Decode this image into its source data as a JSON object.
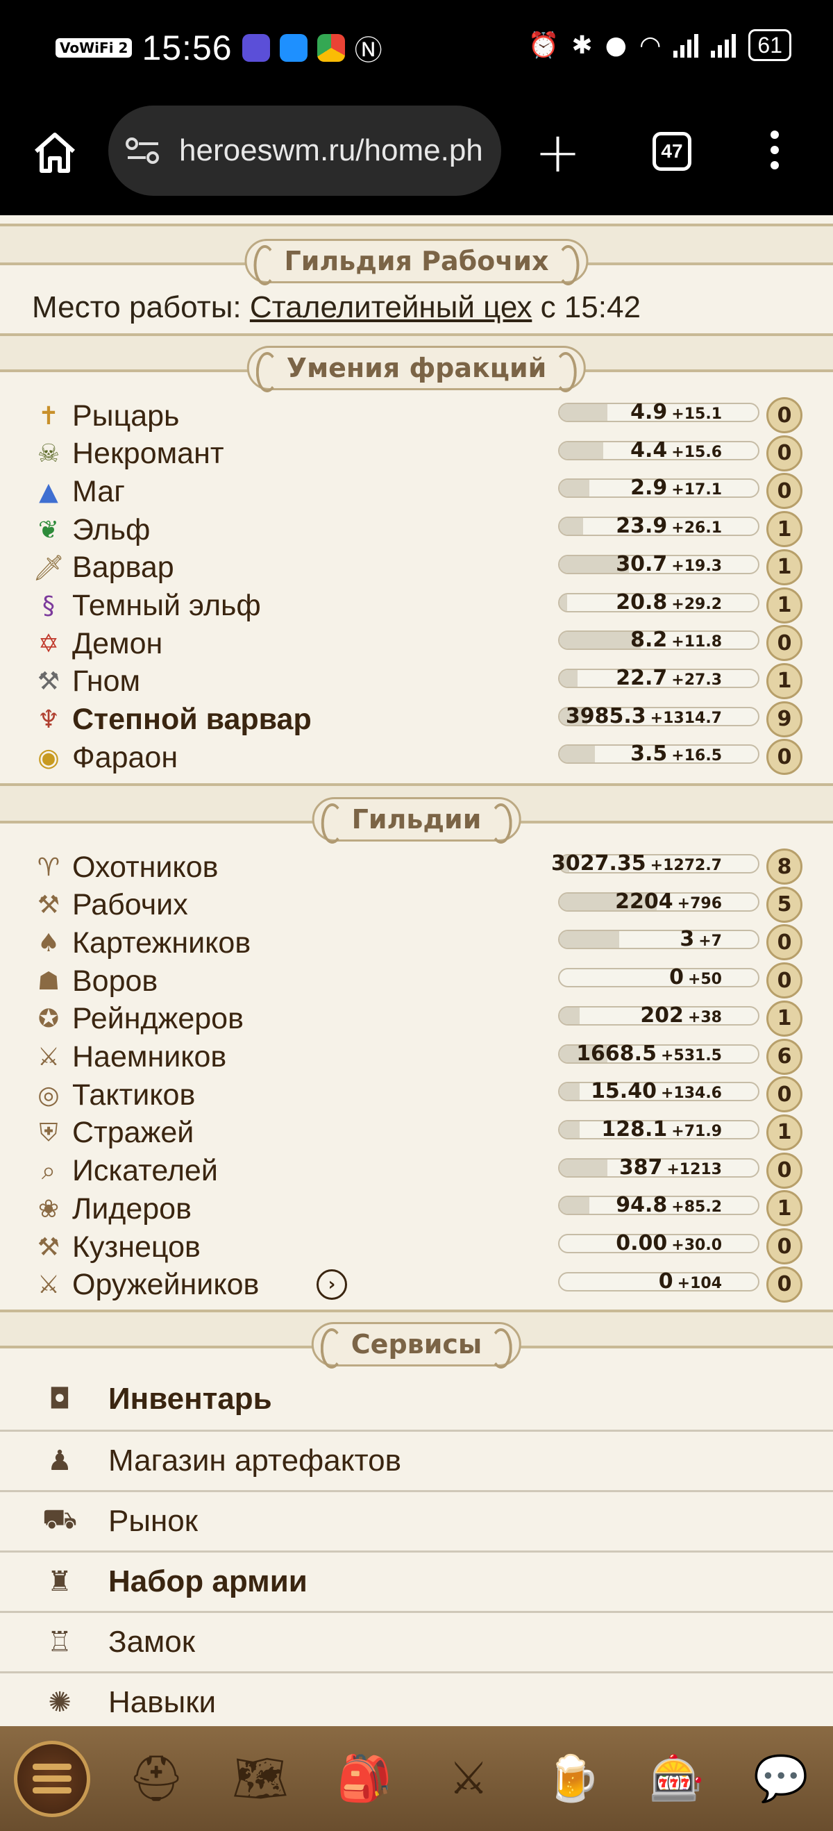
{
  "status_bar": {
    "vowifi": "VoWiFi 2",
    "time": "15:56",
    "battery": "61"
  },
  "browser": {
    "url": "heroeswm.ru/home.ph",
    "tab_count": "47"
  },
  "workers_guild": {
    "title": "Гильдия Рабочих",
    "work_prefix": "Место работы:",
    "workplace": "Сталелитейный цех",
    "since_text": "с 15:42"
  },
  "faction_skills": {
    "title": "Умения фракций",
    "items": [
      {
        "label": "Рыцарь",
        "icon": "cross-icon",
        "value": "4.9",
        "plus": "+15.1",
        "level": "0",
        "progress": 0.24,
        "bold": false
      },
      {
        "label": "Некромант",
        "icon": "skull-icon",
        "value": "4.4",
        "plus": "+15.6",
        "level": "0",
        "progress": 0.22,
        "bold": false
      },
      {
        "label": "Маг",
        "icon": "wizard-hat-icon",
        "value": "2.9",
        "plus": "+17.1",
        "level": "0",
        "progress": 0.15,
        "bold": false
      },
      {
        "label": "Эльф",
        "icon": "leaf-icon",
        "value": "23.9",
        "plus": "+26.1",
        "level": "1",
        "progress": 0.12,
        "bold": false
      },
      {
        "label": "Варвар",
        "icon": "sword-icon",
        "value": "30.7",
        "plus": "+19.3",
        "level": "1",
        "progress": 0.35,
        "bold": false
      },
      {
        "label": "Темный эльф",
        "icon": "dragon-icon",
        "value": "20.8",
        "plus": "+29.2",
        "level": "1",
        "progress": 0.04,
        "bold": false
      },
      {
        "label": "Демон",
        "icon": "pentagram-icon",
        "value": "8.2",
        "plus": "+11.8",
        "level": "0",
        "progress": 0.41,
        "bold": false
      },
      {
        "label": "Гном",
        "icon": "hammer-icon",
        "value": "22.7",
        "plus": "+27.3",
        "level": "1",
        "progress": 0.09,
        "bold": false
      },
      {
        "label": "Степной варвар",
        "icon": "shaman-icon",
        "value": "3985.3",
        "plus": "+1314.7",
        "level": "9",
        "progress": 0.14,
        "bold": true
      },
      {
        "label": "Фараон",
        "icon": "eye-of-ra-icon",
        "value": "3.5",
        "plus": "+16.5",
        "level": "0",
        "progress": 0.18,
        "bold": false
      }
    ]
  },
  "guilds": {
    "title": "Гильдии",
    "items": [
      {
        "label": "Охотников",
        "icon": "deer-skull-icon",
        "value": "3027.35",
        "plus": "+1272.7",
        "level": "8",
        "progress": 0.05
      },
      {
        "label": "Рабочих",
        "icon": "crossed-tools-icon",
        "value": "2204",
        "plus": "+796",
        "level": "5",
        "progress": 0.49
      },
      {
        "label": "Картежников",
        "icon": "cards-icon",
        "value": "3",
        "plus": "+7",
        "level": "0",
        "progress": 0.3
      },
      {
        "label": "Воров",
        "icon": "thief-icon",
        "value": "0",
        "plus": "+50",
        "level": "0",
        "progress": 0.0
      },
      {
        "label": "Рейнджеров",
        "icon": "star-badge-icon",
        "value": "202",
        "plus": "+38",
        "level": "1",
        "progress": 0.1
      },
      {
        "label": "Наемников",
        "icon": "crossed-swords-skull-icon",
        "value": "1668.5",
        "plus": "+531.5",
        "level": "6",
        "progress": 0.24
      },
      {
        "label": "Тактиков",
        "icon": "tactics-icon",
        "value": "15.40",
        "plus": "+134.6",
        "level": "0",
        "progress": 0.1
      },
      {
        "label": "Стражей",
        "icon": "shield-icon",
        "value": "128.1",
        "plus": "+71.9",
        "level": "1",
        "progress": 0.1
      },
      {
        "label": "Искателей",
        "icon": "magnifier-icon",
        "value": "387",
        "plus": "+1213",
        "level": "0",
        "progress": 0.24
      },
      {
        "label": "Лидеров",
        "icon": "laurel-icon",
        "value": "94.8",
        "plus": "+85.2",
        "level": "1",
        "progress": 0.15
      },
      {
        "label": "Кузнецов",
        "icon": "anvil-icon",
        "value": "0.00",
        "plus": "+30.0",
        "level": "0",
        "progress": 0.0
      },
      {
        "label": "Оружейников",
        "icon": "weapons-icon",
        "value": "0",
        "plus": "+104",
        "level": "0",
        "progress": 0.0
      }
    ]
  },
  "services": {
    "title": "Сервисы",
    "items": [
      {
        "label": "Инвентарь",
        "icon": "bag-icon",
        "bold": true
      },
      {
        "label": "Магазин артефактов",
        "icon": "merchant-icon",
        "bold": false
      },
      {
        "label": "Рынок",
        "icon": "market-cart-icon",
        "bold": false
      },
      {
        "label": "Набор армии",
        "icon": "army-icon",
        "bold": true
      },
      {
        "label": "Замок",
        "icon": "castle-icon",
        "bold": false
      },
      {
        "label": "Навыки",
        "icon": "skills-wheel-icon",
        "bold": false
      }
    ]
  },
  "game_nav": [
    {
      "name": "menu-icon"
    },
    {
      "name": "knight-helmet-icon",
      "glyph": "⛑"
    },
    {
      "name": "treasure-map-icon",
      "glyph": "🗺"
    },
    {
      "name": "backpack-icon",
      "glyph": "🎒"
    },
    {
      "name": "crossed-swords-icon",
      "glyph": "⚔"
    },
    {
      "name": "tavern-mug-icon",
      "glyph": "🍺"
    },
    {
      "name": "roulette-icon",
      "glyph": "🎰"
    },
    {
      "name": "chat-icon",
      "glyph": "💬"
    }
  ]
}
